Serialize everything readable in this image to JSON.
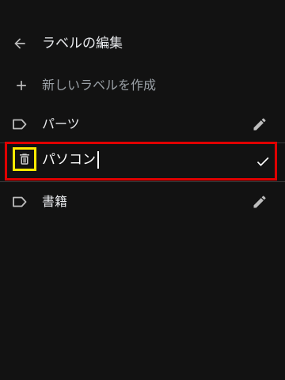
{
  "header": {
    "title": "ラベルの編集",
    "back_icon": "arrow-back-icon"
  },
  "create": {
    "label": "新しいラベルを作成",
    "icon": "plus-icon"
  },
  "labels": [
    {
      "name": "パーツ",
      "icon": "label-outline-icon",
      "action_icon": "pencil-icon"
    },
    {
      "name": "パソコン",
      "icon": "trash-icon",
      "action_icon": "check-icon",
      "editing": true
    },
    {
      "name": "書籍",
      "icon": "label-outline-icon",
      "action_icon": "pencil-icon"
    }
  ],
  "colors": {
    "background": "#121212",
    "text_primary": "#e8eaed",
    "text_secondary": "#9aa0a6",
    "highlight_red": "#e00000",
    "highlight_yellow": "#ffeb00"
  }
}
